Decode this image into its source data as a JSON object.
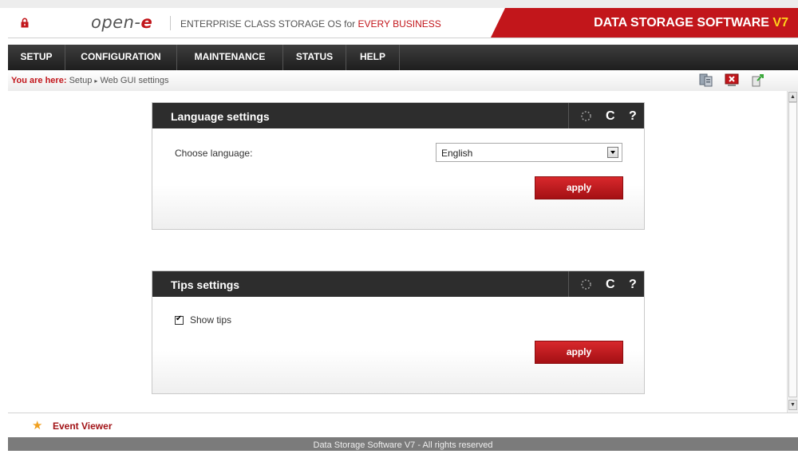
{
  "header": {
    "logo_text": "open-e",
    "tagline_prefix": "ENTERPRISE CLASS STORAGE OS for ",
    "tagline_highlight": "EVERY BUSINESS",
    "brand_title": "DATA STORAGE SOFTWARE ",
    "brand_version": "V7"
  },
  "nav": {
    "items": [
      {
        "label": "SETUP"
      },
      {
        "label": "CONFIGURATION"
      },
      {
        "label": "MAINTENANCE"
      },
      {
        "label": "STATUS"
      },
      {
        "label": "HELP"
      }
    ]
  },
  "breadcrumb": {
    "prefix": "You are here:",
    "path": [
      "Setup",
      "Web GUI settings"
    ],
    "separator": "▸"
  },
  "toolbar": {
    "icons": [
      "server-icon",
      "close-icon",
      "logout-icon"
    ]
  },
  "language_panel": {
    "title": "Language settings",
    "field_label": "Choose language:",
    "selected_language": "English",
    "apply_label": "apply"
  },
  "tips_panel": {
    "title": "Tips settings",
    "checkbox_label": "Show tips",
    "show_tips_checked": true,
    "apply_label": "apply"
  },
  "panel_icons": {
    "refresh": "C",
    "help": "?"
  },
  "event_viewer": {
    "label": "Event Viewer"
  },
  "footer": {
    "text": "Data Storage Software V7 - All rights reserved"
  },
  "colors": {
    "accent_red": "#c2161b",
    "version_yellow": "#ffd21a",
    "nav_dark": "#2d2d2d"
  }
}
